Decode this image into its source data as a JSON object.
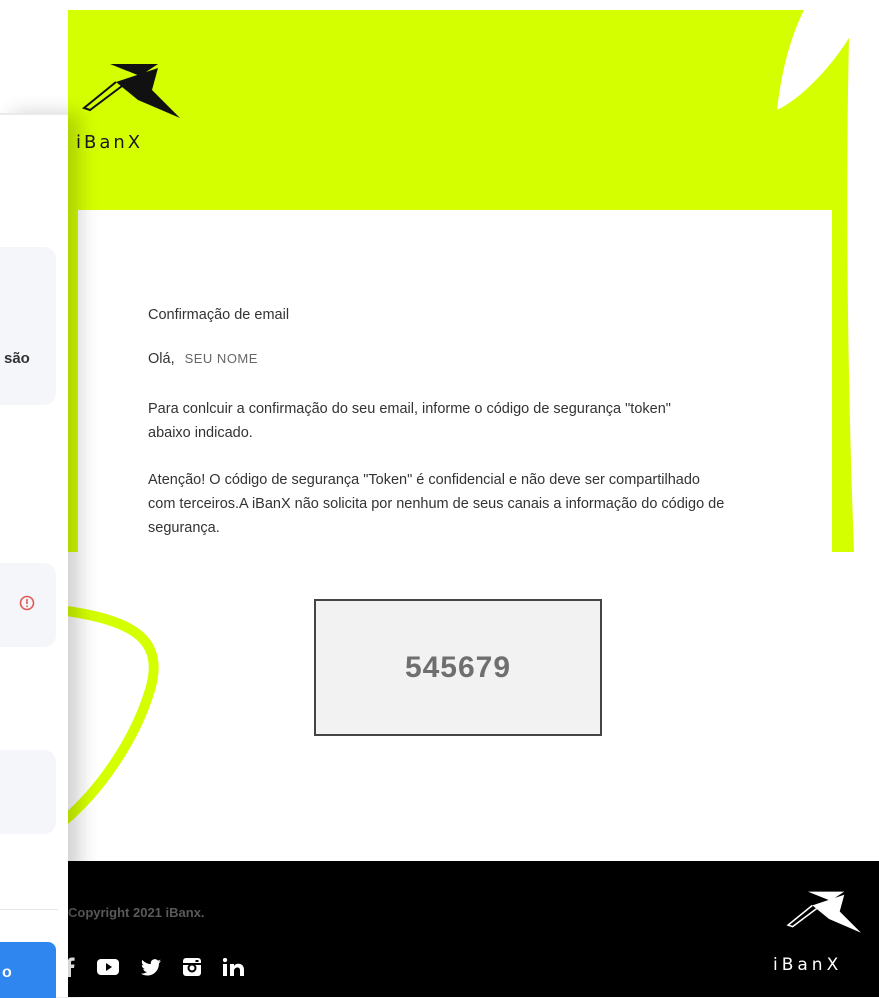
{
  "email": {
    "brand": "iBanX",
    "title": "Confirmação de email",
    "greeting": "Olá,",
    "name_placeholder": "SEU NOME",
    "paragraph1": "Para conlcuir a confirmação do seu email, informe o código de segurança \"token\" abaixo indicado.",
    "paragraph2": "Atenção! O código de segurança \"Token\" é confidencial e não deve ser compartilhado com terceiros.A iBanX não solicita por nenhum de seus canais a informação do código de segurança.",
    "token": "545679",
    "footer": {
      "copyright": "Copyright 2021 iBanx.",
      "brand": "iBanX",
      "social_icons": [
        "facebook-icon",
        "youtube-icon",
        "twitter-icon",
        "instagram-icon",
        "linkedin-icon"
      ]
    }
  },
  "left_panel": {
    "card1_text": "são",
    "alert_icon": "alert-circle-icon",
    "button_text": "o"
  },
  "colors": {
    "lime": "#d4ff00",
    "footer_bg": "#000000",
    "alert": "#e05a5a",
    "primary_button": "#2f86ee"
  }
}
